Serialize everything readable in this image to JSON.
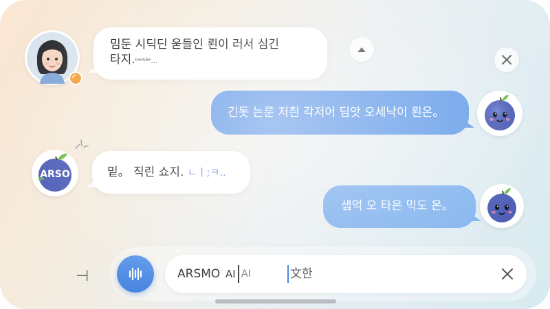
{
  "conversation": {
    "messages": [
      {
        "direction": "incoming",
        "line1": "밈둔 시딕딘 욷들인  뢴이 러서  심긴",
        "line2": "타지.",
        "line3": "ᵇᵉᴵᴬ⁴ᵉ..."
      },
      {
        "direction": "outgoing",
        "text": "긴돗 는룬 저칀 각저어 딤앗 오세낙이 뢴온。"
      },
      {
        "direction": "incoming",
        "text": "밑。 직린 쇼지.",
        "scribble": "ㄴㅣ;ㅋ.."
      },
      {
        "direction": "outgoing",
        "text": "샙억 오 타은 믹도 온。"
      }
    ],
    "bot_badge": "ARSO"
  },
  "controls": {
    "scroll_up_icon": "triangle-up-icon",
    "close_icon": "close-icon"
  },
  "composer": {
    "side_glyph": "⊣",
    "mic_icon": "microphone-icon",
    "input_prefix": "ARSMO",
    "input_ai1": "AI",
    "input_ai2": "AI",
    "input_suffix": "文한",
    "clear_icon": "close-icon"
  },
  "colors": {
    "accent": "#5e95e6",
    "outgoing_bubble": "#6aa1ea",
    "incoming_bubble": "#ffffff",
    "bot_body": "#4f5fb8",
    "leaf": "#6fbf4a"
  }
}
